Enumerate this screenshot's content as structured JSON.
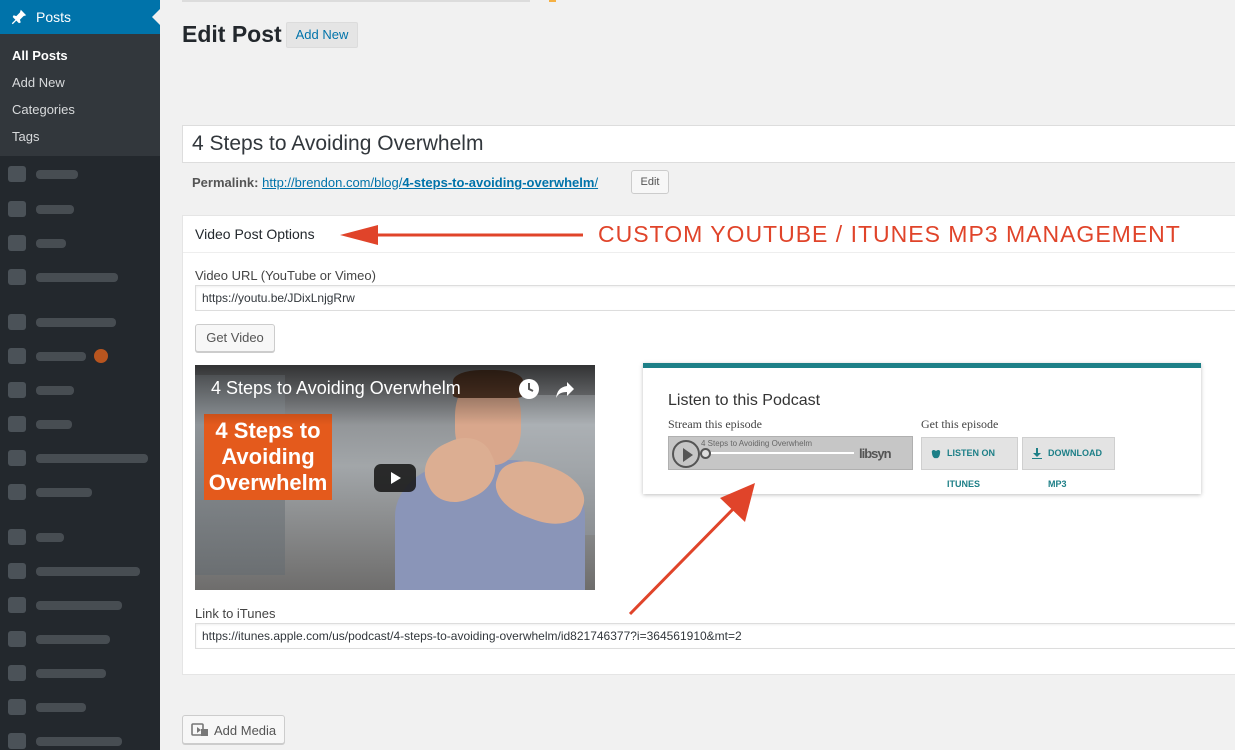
{
  "sidebar": {
    "active_menu": "Posts",
    "submenu": [
      "All Posts",
      "Add New",
      "Categories",
      "Tags"
    ],
    "accent_color": "#0073aa"
  },
  "page": {
    "title": "Edit Post",
    "add_new_label": "Add New"
  },
  "post": {
    "title": "4 Steps to Avoiding Overwhelm",
    "permalink_label": "Permalink:",
    "permalink_base": "http://brendon.com/blog/",
    "permalink_slug": "4-steps-to-avoiding-overwhelm",
    "permalink_tail": "/",
    "permalink_edit": "Edit"
  },
  "video_options": {
    "box_title": "Video Post Options",
    "video_url_label": "Video URL (YouTube or Vimeo)",
    "video_url_value": "https://youtu.be/JDixLnjgRrw",
    "get_video_label": "Get Video",
    "video_title": "4 Steps to Avoiding Overwhelm",
    "thumbnail_text": [
      "4 Steps to",
      "Avoiding",
      "Overwhelm"
    ],
    "itunes_label": "Link to iTunes",
    "itunes_value": "https://itunes.apple.com/us/podcast/4-steps-to-avoiding-overwhelm/id821746377?i=364561910&mt=2"
  },
  "podcast": {
    "title": "Listen to this Podcast",
    "stream_label": "Stream this episode",
    "get_label": "Get this episode",
    "player_episode": "4 Steps to Avoiding Overwhelm",
    "player_brand": "libsyn",
    "itunes_button": "LISTEN ON ITUNES",
    "mp3_button": "DOWNLOAD MP3",
    "accent_color": "#1d7f87"
  },
  "annotation": {
    "text": "CUSTOM YOUTUBE / ITUNES MP3 MANAGEMENT",
    "color": "#e0442a"
  },
  "add_media_label": "Add Media"
}
